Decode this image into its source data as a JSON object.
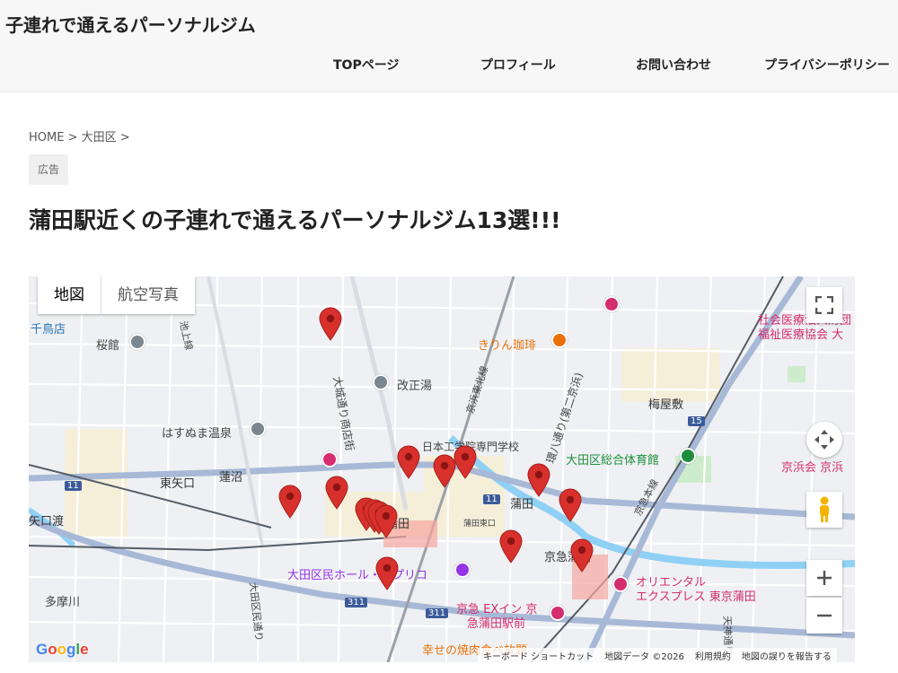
{
  "header": {
    "site_title": "子連れで通えるパーソナルジム",
    "nav": [
      {
        "label": "TOPページ"
      },
      {
        "label": "プロフィール"
      },
      {
        "label": "お問い合わせ"
      },
      {
        "label": "プライバシーポリシー"
      }
    ]
  },
  "breadcrumb": {
    "home": "HOME",
    "sep1": ">",
    "area": "大田区",
    "sep2": ">"
  },
  "ad_badge": "広告",
  "page_title": "蒲田駅近くの子連れで通えるパーソナルジム13選!!!",
  "map": {
    "map_type_active": "地図",
    "map_type_other": "航空写真",
    "labels": {
      "chidoriten": "千鳥店",
      "sakurakan": "桜館",
      "kaishoyu": "改正湯",
      "kirin": "きりん珈琲",
      "hasunuma_onsen": "はすぬま温泉",
      "higashi_yaguchi": "東矢口",
      "hasunuma": "蓮沼",
      "nihon_kogakuin": "日本工学院専門学校",
      "kamata": "蒲田",
      "kamata_jr": "蒲田",
      "ota_gym": "大田区総合体育館",
      "umeyashiki": "梅屋敷",
      "shakai_iryo": "社会医療法人財団",
      "fukushi": "福祉医療協会 大",
      "keihinkai": "京浜会 京浜",
      "yaguchi_watashi": "矢口渡",
      "ota_hall": "大田区民ホール・アプリコ",
      "keikyu_kamata": "京急蒲田",
      "oriental": "オリエンタル",
      "oriental2": "エクスプレス 東京蒲田",
      "ex_inn": "京急 EXイン 京",
      "ex_inn2": "急蒲田駅前",
      "tamagawa": "多摩川",
      "yakiniku": "幸せの焼肉食べ放題",
      "ikegami": "池上線",
      "oshiro_street": "大城通り商店街",
      "keihin_tohoku": "京浜東北線",
      "kanpachi": "環八通り(第二京浜)",
      "keikyu_line": "京急本線",
      "ota_ku_street": "大田区民通り",
      "kamata_higashi": "蒲田東口",
      "road_11a": "11",
      "road_11b": "11",
      "road_15": "15",
      "road_311a": "311",
      "road_311b": "311",
      "tenjin": "天神通り"
    },
    "footer": {
      "shortcuts": "キーボード ショートカット",
      "map_data": "地図データ ©2026",
      "terms": "利用規約",
      "report": "地図の誤りを報告する"
    },
    "google": "Google",
    "marker_count": 18
  },
  "colors": {
    "marker": "#d8302c",
    "poi_gray": "#7b8790",
    "poi_green": "#1e8e3e",
    "poi_orange": "#e8710a",
    "poi_pink": "#d62d6f",
    "water": "#8fd0f5",
    "road_major": "#a7b9d6",
    "park": "#cdeccb"
  }
}
